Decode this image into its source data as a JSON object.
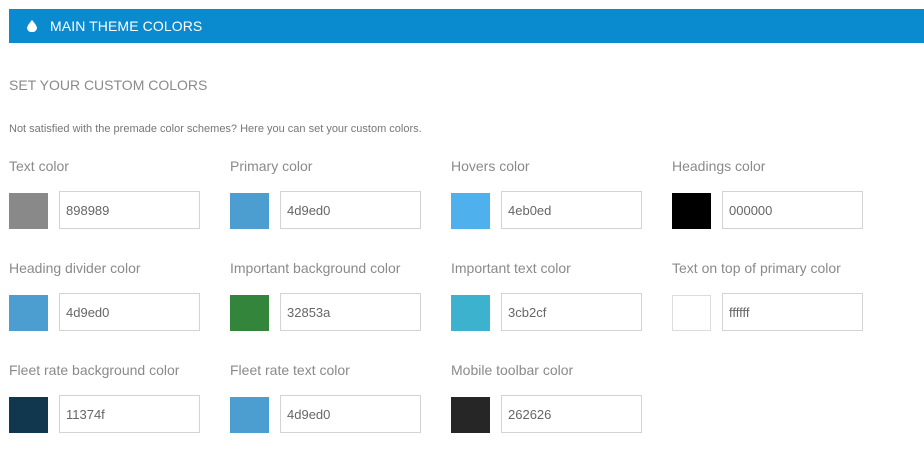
{
  "header": {
    "title": "MAIN THEME COLORS",
    "icon": "drop-icon",
    "background": "#0a8bcf"
  },
  "section": {
    "title": "SET YOUR CUSTOM COLORS",
    "description": "Not satisfied with the premade color schemes? Here you can set your custom colors."
  },
  "fields": [
    {
      "label": "Text color",
      "value": "898989",
      "color": "#898989"
    },
    {
      "label": "Primary color",
      "value": "4d9ed0",
      "color": "#4d9ed0"
    },
    {
      "label": "Hovers color",
      "value": "4eb0ed",
      "color": "#4eb0ed"
    },
    {
      "label": "Headings color",
      "value": "000000",
      "color": "#000000"
    },
    {
      "label": "Heading divider color",
      "value": "4d9ed0",
      "color": "#4d9ed0"
    },
    {
      "label": "Important background color",
      "value": "32853a",
      "color": "#32853a"
    },
    {
      "label": "Important text color",
      "value": "3cb2cf",
      "color": "#3cb2cf"
    },
    {
      "label": "Text on top of primary color",
      "value": "ffffff",
      "color": "#ffffff"
    },
    {
      "label": "Fleet rate background color",
      "value": "11374f",
      "color": "#11374f"
    },
    {
      "label": "Fleet rate text color",
      "value": "4d9ed0",
      "color": "#4d9ed0"
    },
    {
      "label": "Mobile toolbar color",
      "value": "262626",
      "color": "#262626"
    }
  ]
}
